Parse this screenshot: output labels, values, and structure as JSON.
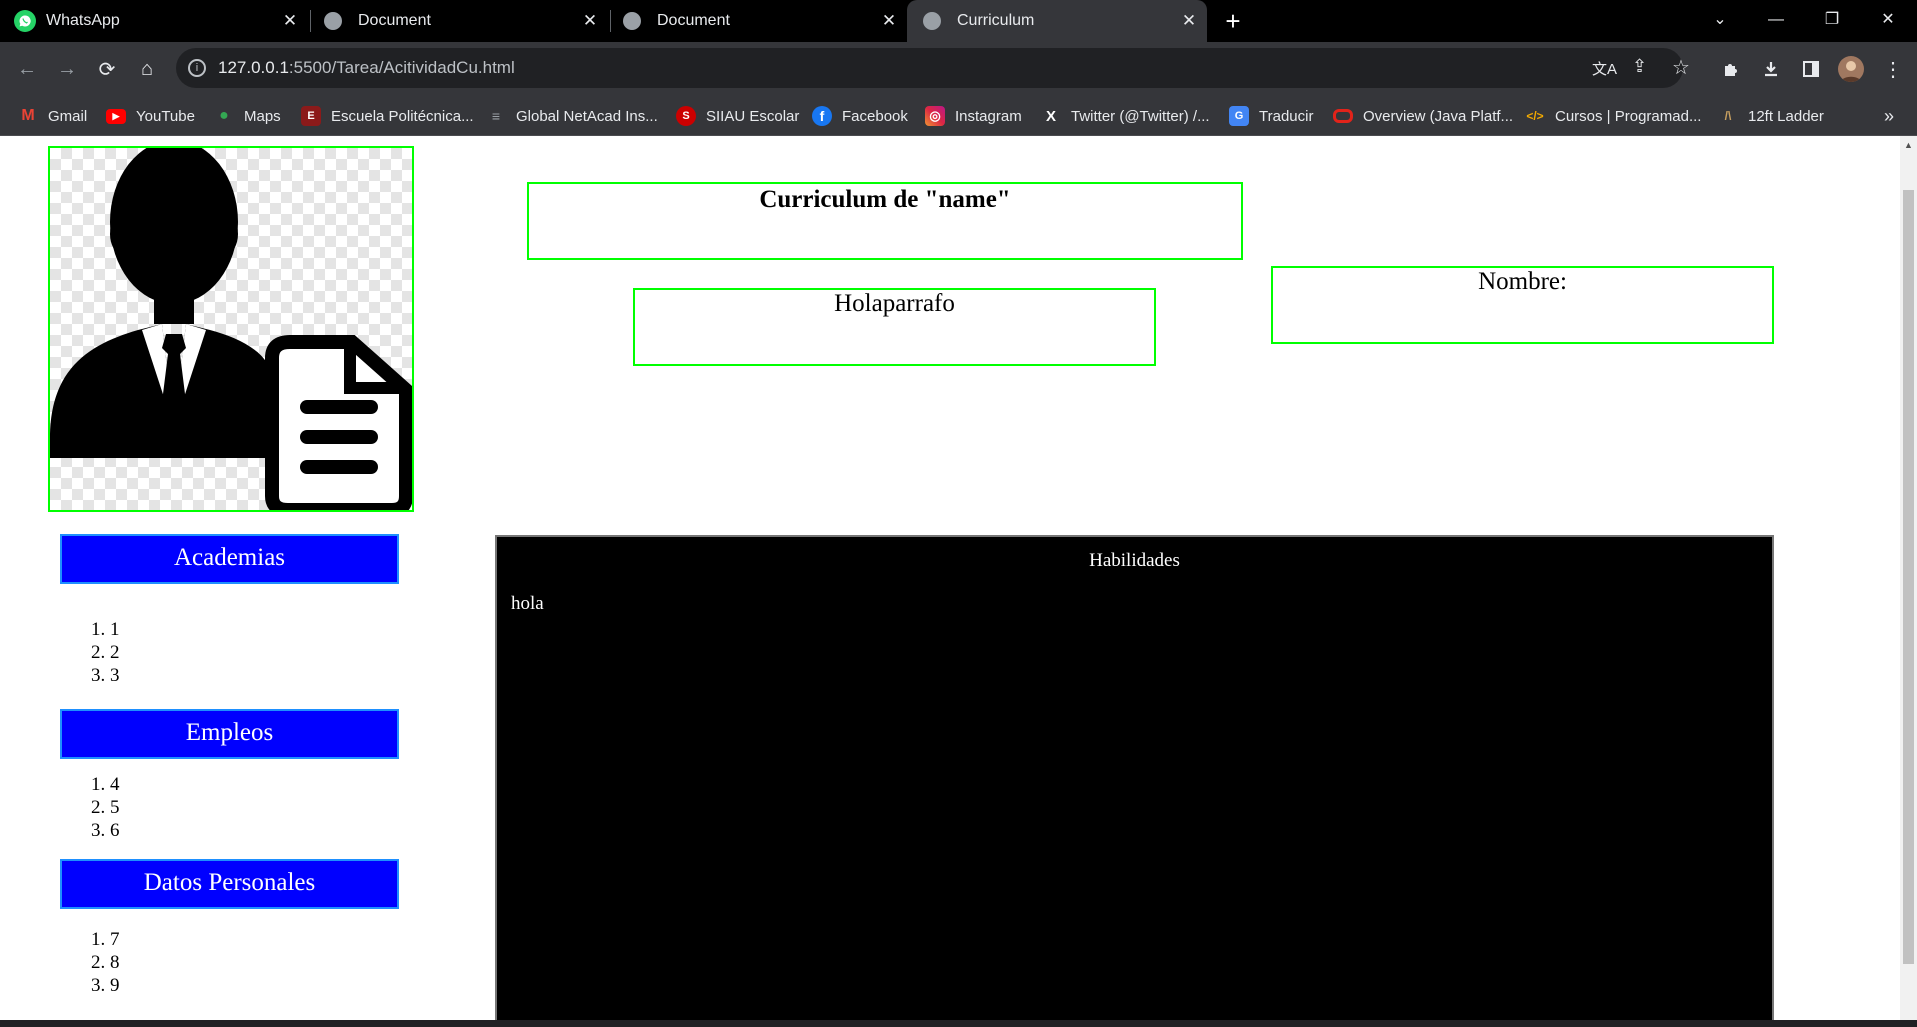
{
  "tabs": [
    {
      "title": "WhatsApp"
    },
    {
      "title": "Document"
    },
    {
      "title": "Document"
    },
    {
      "title": "Curriculum"
    }
  ],
  "toolbar": {
    "url_host": "127.0.0.1",
    "url_path": ":5500/Tarea/AcitividadCu.html"
  },
  "bookmarks": [
    {
      "label": "Gmail",
      "color": "#ea4335",
      "glyph": "M"
    },
    {
      "label": "YouTube",
      "color": "#ff0000",
      "glyph": "▶"
    },
    {
      "label": "Maps",
      "color": "#34a853",
      "glyph": "●"
    },
    {
      "label": "Escuela Politécnica...",
      "color": "#8b1a1a",
      "glyph": "E"
    },
    {
      "label": "Global NetAcad Ins...",
      "color": "#5f6368",
      "glyph": "≡"
    },
    {
      "label": "SIIAU Escolar",
      "color": "#cc0000",
      "glyph": "S"
    },
    {
      "label": "Facebook",
      "color": "#1877f2",
      "glyph": "f"
    },
    {
      "label": "Instagram",
      "color": "#d6249f",
      "glyph": "◎"
    },
    {
      "label": "Twitter (@Twitter) /...",
      "color": "#000000",
      "glyph": "X"
    },
    {
      "label": "Traducir",
      "color": "#4285f4",
      "glyph": "G"
    },
    {
      "label": "Overview (Java Platf...",
      "color": "#e2231a",
      "glyph": "O"
    },
    {
      "label": "Cursos | Programad...",
      "color": "#f2a900",
      "glyph": "</>"
    },
    {
      "label": "12ft Ladder",
      "color": "#8a6d3b",
      "glyph": "/\\"
    }
  ],
  "page": {
    "title": "Curriculum de \"name\"",
    "paragraph": "Holaparrafo",
    "name_label": "Nombre:",
    "sections": [
      {
        "heading": "Academias",
        "items": [
          "1",
          "2",
          "3"
        ]
      },
      {
        "heading": "Empleos",
        "items": [
          "4",
          "5",
          "6"
        ]
      },
      {
        "heading": "Datos Personales",
        "items": [
          "7",
          "8",
          "9"
        ]
      }
    ],
    "skills_title": "Habilidades",
    "skills_text": "hola"
  }
}
